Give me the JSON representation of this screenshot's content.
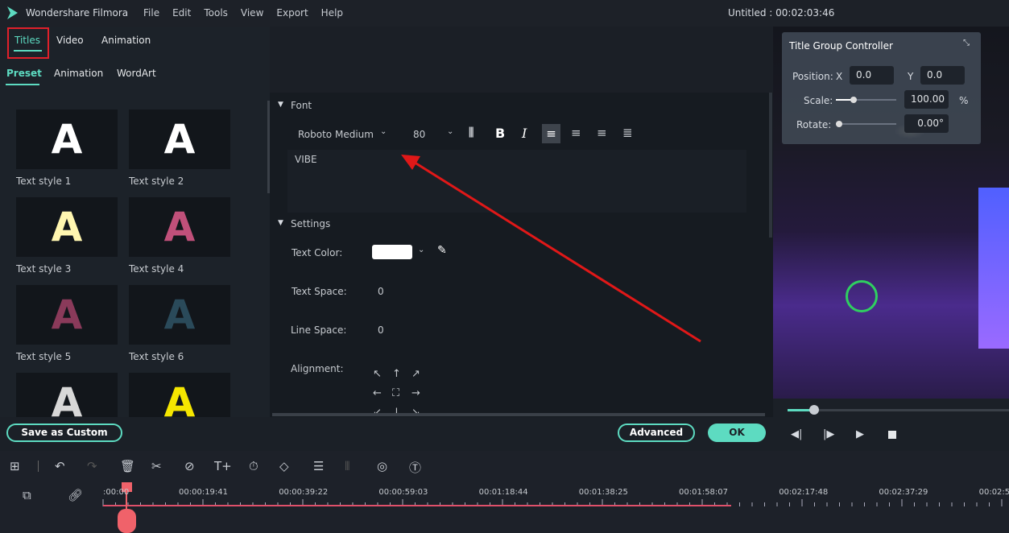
{
  "app": {
    "title": "Wondershare Filmora",
    "project": "Untitled : 00:02:03:46",
    "menu": [
      "File",
      "Edit",
      "Tools",
      "View",
      "Export",
      "Help"
    ]
  },
  "tabs": {
    "main": [
      "Titles",
      "Video",
      "Animation"
    ],
    "active": "Titles",
    "sub": [
      "Preset",
      "Animation",
      "WordArt"
    ],
    "sub_active": "Preset"
  },
  "presets": [
    {
      "label": "Text style 1",
      "color": "#ffffff"
    },
    {
      "label": "Text style 2",
      "color": "#ffffff"
    },
    {
      "label": "Text style 3",
      "color": "#fff6b0"
    },
    {
      "label": "Text style 4",
      "color": "#c0507a"
    },
    {
      "label": "Text style 5",
      "color": "#8a3a5a"
    },
    {
      "label": "Text style 6",
      "color": "#2a4a5a"
    },
    {
      "label": "",
      "color": "#d8d8d8"
    },
    {
      "label": "",
      "color": "#f5e600"
    }
  ],
  "font": {
    "section": "Font",
    "family": "Roboto Medium",
    "size": "80",
    "text": "VIBE"
  },
  "settings": {
    "section": "Settings",
    "text_color_label": "Text Color:",
    "text_color": "#ffffff",
    "text_space_label": "Text Space:",
    "text_space": "0",
    "line_space_label": "Line Space:",
    "line_space": "0",
    "alignment_label": "Alignment:"
  },
  "buttons": {
    "save_custom": "Save as Custom",
    "advanced": "Advanced",
    "ok": "OK"
  },
  "controller": {
    "title": "Title Group Controller",
    "position_label": "Position:",
    "x_label": "X",
    "x": "0.0",
    "y_label": "Y",
    "y": "0.0",
    "scale_label": "Scale:",
    "scale": "100.00",
    "scale_unit": "%",
    "rotate_label": "Rotate:",
    "rotate": "0.00°"
  },
  "playback": {
    "progress": 0.12
  },
  "timeline": {
    "timestamps": [
      ":00:00",
      "00:00:19:41",
      "00:00:39:22",
      "00:00:59:03",
      "00:01:18:44",
      "00:01:38:25",
      "00:01:58:07",
      "00:02:17:48",
      "00:02:37:29",
      "00:02:5"
    ]
  },
  "colors": {
    "accent": "#5ddbc1",
    "playhead": "#f0626a",
    "highlight_box": "#e0202a",
    "arrow": "#e01818"
  }
}
